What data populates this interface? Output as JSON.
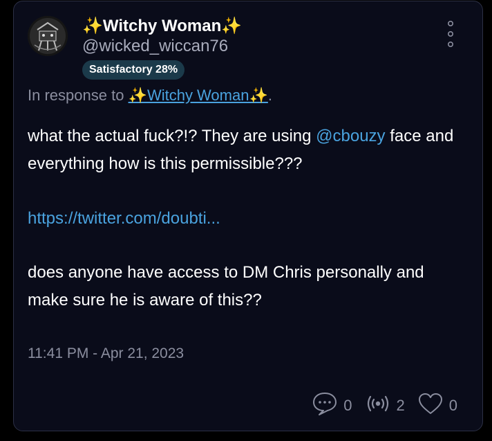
{
  "post": {
    "author": {
      "display_name": "✨Witchy Woman✨",
      "handle": "@wicked_wiccan76",
      "badge": "Satisfactory 28%"
    },
    "in_response_prefix": "In response to ",
    "in_response_name": "✨Witchy Woman✨",
    "in_response_suffix": ".",
    "text_1_before": "what the actual fuck?!? They are using ",
    "text_1_mention": "@cbouzy",
    "text_1_after": " face and everything how is this permissible???",
    "link": "https://twitter.com/doubti...",
    "text_2": "does anyone have access to DM Chris personally and make sure he is aware of this??",
    "timestamp": "11:41 PM - Apr 21, 2023",
    "actions": {
      "replies": "0",
      "broadcasts": "2",
      "likes": "0"
    }
  },
  "icons": {
    "more": "vertical-ellipsis-icon",
    "reply": "chat-bubble-icon",
    "broadcast": "broadcast-icon",
    "like": "heart-icon"
  },
  "colors": {
    "background": "#000000",
    "card": "#0a0c1a",
    "border": "#2c3045",
    "link": "#4aa3df",
    "muted": "#8b8e9f",
    "badge": "#1b3a4a"
  }
}
